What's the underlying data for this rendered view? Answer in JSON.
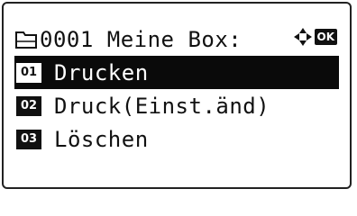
{
  "header": {
    "icon": "box-icon",
    "title": "0001 Meine Box:",
    "nav_icon": "dpad-icon",
    "ok_label": "OK"
  },
  "menu": {
    "items": [
      {
        "number": "01",
        "label": "Drucken",
        "selected": true
      },
      {
        "number": "02",
        "label": "Druck(Einst.änd)",
        "selected": false
      },
      {
        "number": "03",
        "label": "Löschen",
        "selected": false
      }
    ]
  },
  "colors": {
    "selection_bg": "#0a0a0a",
    "text": "#111111",
    "background": "#ffffff"
  }
}
